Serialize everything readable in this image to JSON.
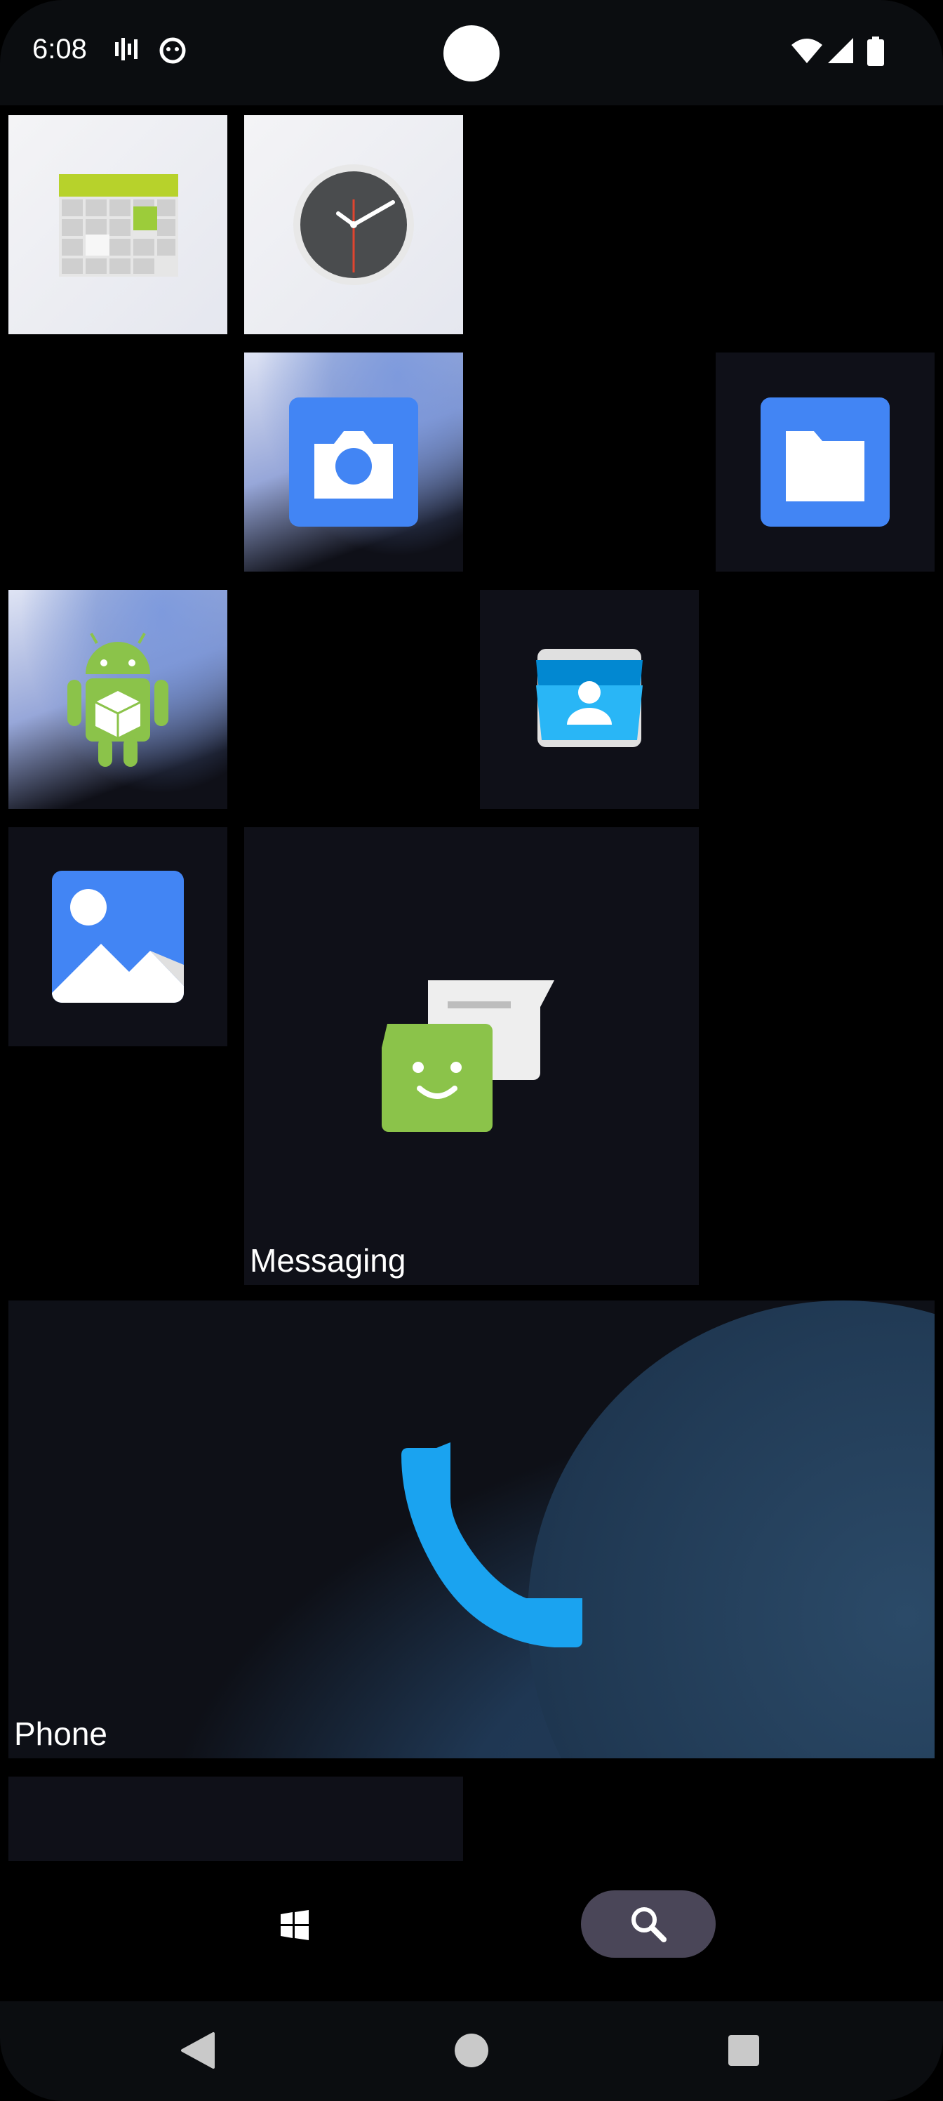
{
  "status_bar": {
    "time": "6:08"
  },
  "tiles": {
    "messaging_label": "Messaging",
    "phone_label": "Phone"
  },
  "icons": {
    "calendar": "calendar-icon",
    "clock": "clock-icon",
    "camera": "camera-icon",
    "files": "folder-icon",
    "android": "android-icon",
    "contacts": "contacts-icon",
    "gallery": "gallery-icon",
    "messaging": "messaging-icon",
    "phone": "phone-icon",
    "windows": "windows-icon",
    "search": "search-icon"
  },
  "colors": {
    "google_blue": "#4285f4",
    "android_green": "#8bc34a",
    "phone_blue": "#1aa3f0",
    "search_pill": "#4a4658"
  }
}
